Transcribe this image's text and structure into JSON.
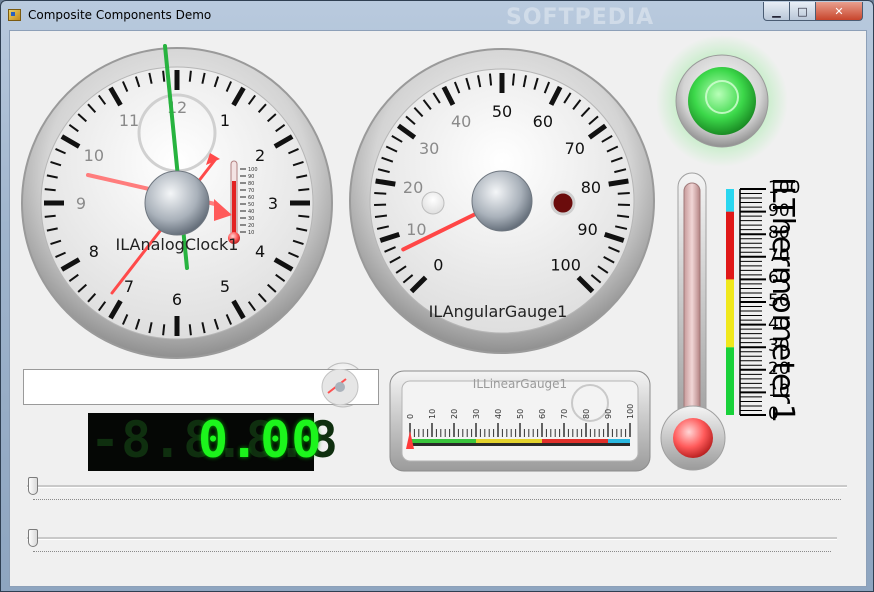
{
  "window": {
    "title": "Composite Components Demo",
    "watermark": "SOFTPEDIA",
    "controls": {
      "minimize": "▁",
      "maximize": "□",
      "close": "✕"
    }
  },
  "analog_clock": {
    "name": "ILAnalogClock1",
    "numbers": [
      "12",
      "1",
      "2",
      "3",
      "4",
      "5",
      "6",
      "7",
      "8",
      "9",
      "10",
      "11"
    ],
    "mini_thermometer_ticks": [
      "10",
      "20",
      "30",
      "40",
      "50",
      "60",
      "70",
      "80",
      "90",
      "100"
    ]
  },
  "angular_gauge": {
    "name": "ILAngularGauge1",
    "scale": [
      "0",
      "10",
      "20",
      "30",
      "40",
      "50",
      "60",
      "70",
      "80",
      "90",
      "100"
    ],
    "value": 7
  },
  "led_indicator": {
    "state": "on",
    "color": "#3cd84a"
  },
  "thermometer": {
    "name": "ILThermometer1",
    "scale": [
      "0",
      "10",
      "20",
      "30",
      "40",
      "50",
      "60",
      "70",
      "80",
      "90",
      "100"
    ],
    "bands": [
      {
        "from": 0,
        "to": 30,
        "color": "#19d13a"
      },
      {
        "from": 30,
        "to": 60,
        "color": "#f0e81c"
      },
      {
        "from": 60,
        "to": 90,
        "color": "#e01818"
      },
      {
        "from": 90,
        "to": 100,
        "color": "#2ad7f0"
      }
    ]
  },
  "text_box": {
    "value": "",
    "placeholder": ""
  },
  "seven_segment": {
    "dim_text": "-8.8.8.8",
    "lit_text": "0.00"
  },
  "linear_gauge": {
    "name": "ILLinearGauge1",
    "scale": [
      "0",
      "10",
      "20",
      "30",
      "40",
      "50",
      "60",
      "70",
      "80",
      "90",
      "100"
    ],
    "value": 0
  },
  "sliders": [
    {
      "value": 0,
      "max": 100
    },
    {
      "value": 0,
      "max": 100
    }
  ]
}
